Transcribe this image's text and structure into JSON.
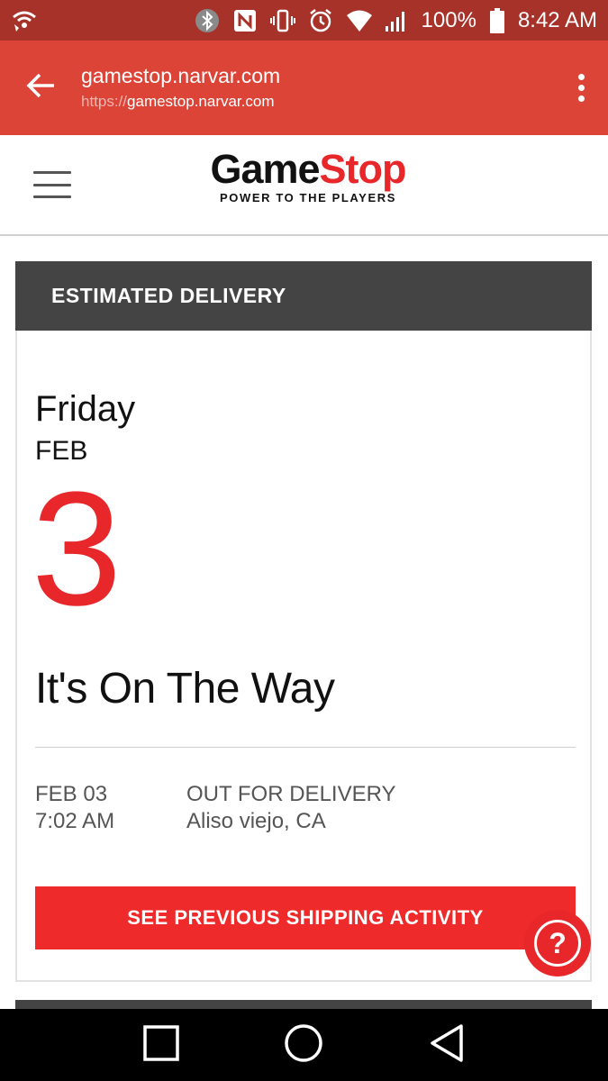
{
  "status_bar": {
    "battery": "100%",
    "time": "8:42 AM",
    "icons": [
      "wifi-call-icon",
      "bluetooth-icon",
      "nfc-icon",
      "vibrate-icon",
      "alarm-icon",
      "wifi-icon",
      "signal-icon",
      "battery-icon"
    ]
  },
  "browser": {
    "host": "gamestop.narvar.com",
    "scheme": "https://",
    "path": "gamestop.narvar.com"
  },
  "header": {
    "logo_part1": "Game",
    "logo_part2": "Stop",
    "tagline": "POWER TO THE PLAYERS"
  },
  "delivery": {
    "section_title": "ESTIMATED DELIVERY",
    "day": "Friday",
    "month": "FEB",
    "date": "3",
    "status": "It's On The Way",
    "event": {
      "date": "FEB 03",
      "time": "7:02 AM",
      "description": "OUT FOR DELIVERY",
      "location": "Aliso viejo, CA"
    },
    "cta_label": "SEE PREVIOUS SHIPPING ACTIVITY"
  },
  "help": {
    "label": "?"
  },
  "colors": {
    "status_bar": "#a6322a",
    "url_bar": "#db4437",
    "brand_red": "#e8272a",
    "card_header": "#444444"
  }
}
